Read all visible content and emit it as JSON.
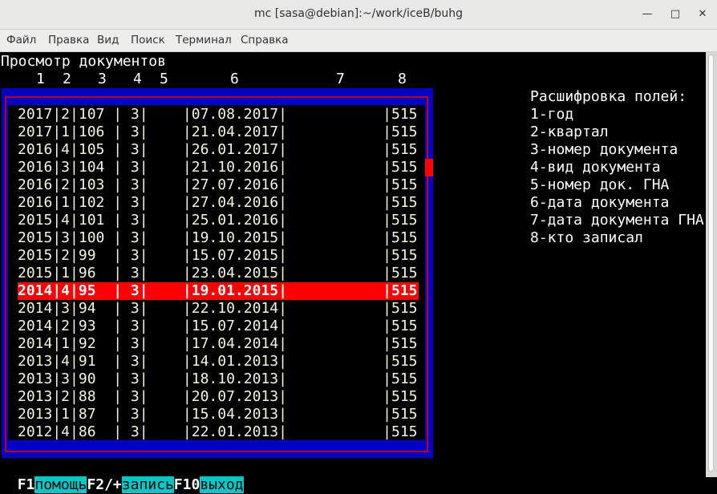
{
  "window": {
    "title": "mc [sasa@debian]:~/work/iceB/buhg"
  },
  "menu": [
    "Файл",
    "Правка",
    "Вид",
    "Поиск",
    "Терминал",
    "Справка"
  ],
  "screen": {
    "heading": "Просмотр документов",
    "columns": [
      "1",
      "2",
      "3",
      "4",
      "5",
      "6",
      "7",
      "8"
    ],
    "rows": [
      "2017|2|107 | 3|    |07.08.2017|           |515",
      "2017|1|106 | 3|    |21.04.2017|           |515",
      "2016|4|105 | 3|    |26.01.2017|           |515",
      "2016|3|104 | 3|    |21.10.2016|           |515",
      "2016|2|103 | 3|    |27.07.2016|           |515",
      "2016|1|102 | 3|    |27.04.2016|           |515",
      "2015|4|101 | 3|    |25.01.2016|           |515",
      "2015|3|100 | 3|    |19.10.2015|           |515",
      "2015|2|99  | 3|    |15.07.2015|           |515",
      "2015|1|96  | 3|    |23.04.2015|           |515",
      "2014|4|95  | 3|    |19.01.2015|           |515",
      "2014|3|94  | 3|    |22.10.2014|           |515",
      "2014|2|93  | 3|    |15.07.2014|           |515",
      "2014|1|92  | 3|    |17.04.2014|           |515",
      "2013|4|91  | 3|    |14.01.2013|           |515",
      "2013|3|90  | 3|    |18.10.2013|           |515",
      "2013|2|88  | 3|    |20.07.2013|           |515",
      "2013|1|87  | 3|    |15.04.2013|           |515",
      "2012|4|86  | 3|    |22.01.2013|           |515"
    ],
    "selected_row": 10,
    "legend": [
      "Расшифровка полей:",
      "1-год",
      "2-квартал",
      "3-номер документа",
      "4-вид документа",
      "5-номер док. ГНА",
      "6-дата документа",
      "7-дата документа ГНА",
      "8-кто записал"
    ],
    "fkeys": [
      {
        "key": "F1",
        "label": "помощь"
      },
      {
        "key": "F2/+",
        "label": "запись"
      },
      {
        "key": "F10",
        "label": "выход"
      }
    ]
  },
  "colors": {
    "frame": "#0000c8",
    "selection": "#ff0000",
    "fkey_label_bg": "#00c8c8"
  }
}
